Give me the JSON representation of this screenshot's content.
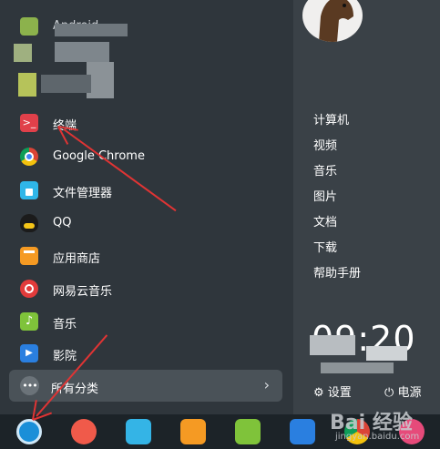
{
  "apps": [
    {
      "label": "终端"
    },
    {
      "label": "Google Chrome"
    },
    {
      "label": "文件管理器"
    },
    {
      "label": "QQ"
    },
    {
      "label": "应用商店"
    },
    {
      "label": "网易云音乐"
    },
    {
      "label": "音乐"
    },
    {
      "label": "影院"
    }
  ],
  "top_obscured_text": "Android",
  "all_categories_label": "所有分类",
  "folders": [
    "计算机",
    "视频",
    "音乐",
    "图片",
    "文档",
    "下载",
    "帮助手册"
  ],
  "clock": "09:20",
  "settings_label": "设置",
  "power_label": "电源",
  "watermark": {
    "brand": "Bai 经验",
    "domain": "jingyan.baidu.com"
  },
  "colors": {
    "panel": "#2f363c",
    "right_panel": "#3a4147",
    "dock": "#1c2328",
    "arrow": "#e03434"
  },
  "icons": {
    "terminal": "terminal-icon",
    "chrome": "chrome-icon",
    "files": "folder-icon",
    "qq": "qq-penguin-icon",
    "store": "store-bag-icon",
    "netease": "netease-music-icon",
    "music": "music-note-icon",
    "cinema": "film-icon"
  }
}
